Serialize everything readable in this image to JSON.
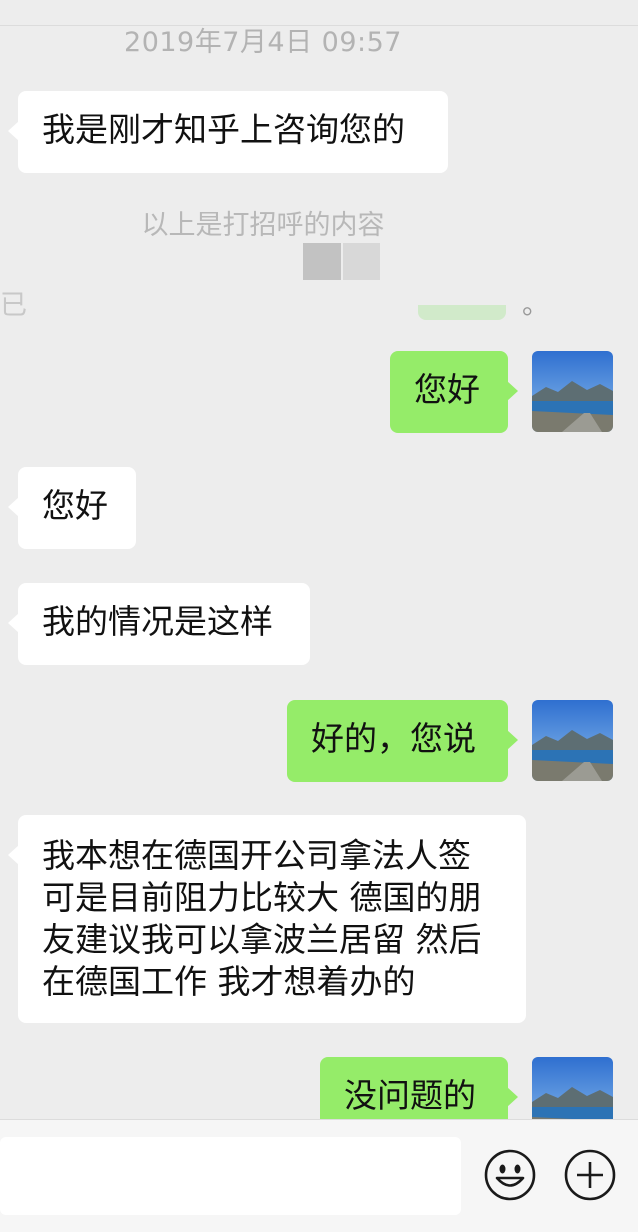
{
  "timestamp": "2019年7月4日 09:57",
  "system": {
    "greeting_note": "以上是打招呼的内容",
    "partial_prefix": "已",
    "partial_suffix": "。"
  },
  "messages": [
    {
      "side": "in",
      "text": "我是刚才知乎上咨询您的"
    },
    {
      "side": "out",
      "text": "您好"
    },
    {
      "side": "in",
      "text": "您好"
    },
    {
      "side": "in",
      "text": "我的情况是这样"
    },
    {
      "side": "out",
      "text": "好的，您说"
    },
    {
      "side": "in",
      "lines": [
        "我本想在德国开公司拿法人签",
        "可是目前阻力比较大 德国的朋",
        "友建议我可以拿波兰居留 然后",
        "在德国工作 我才想着办的"
      ]
    },
    {
      "side": "out",
      "text": "没问题的"
    }
  ],
  "input_bar": {
    "input_value": "",
    "emoji_icon": "emoji-icon",
    "plus_icon": "plus-icon"
  },
  "colors": {
    "background": "#ededed",
    "outgoing_bubble": "#95ec69",
    "incoming_bubble": "#ffffff"
  }
}
